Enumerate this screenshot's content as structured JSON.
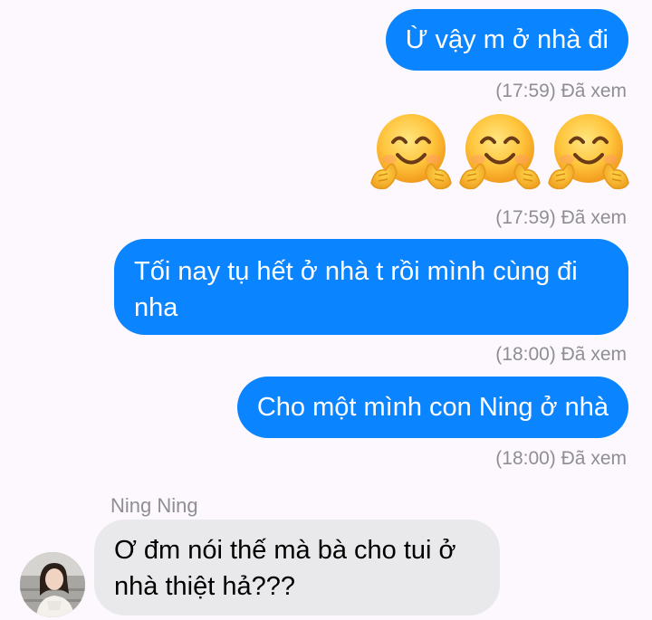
{
  "messages": [
    {
      "text": "Ừ  vậy m ở nhà đi",
      "status": "(17:59) Đã xem"
    },
    {
      "emojis": [
        "hugging-face-emoji",
        "hugging-face-emoji",
        "hugging-face-emoji"
      ],
      "status": "(17:59) Đã xem"
    },
    {
      "text": "Tối nay tụ hết ở nhà t rồi mình cùng đi nha",
      "status": "(18:00) Đã xem"
    },
    {
      "text": "Cho một mình con Ning ở nhà",
      "status": "(18:00) Đã xem"
    }
  ],
  "incoming": {
    "sender": "Ning Ning",
    "text": "Ơ đm nói thế mà bà cho tui ở nhà thiệt hả???"
  },
  "colors": {
    "outgoing_bubble": "#0a84ff",
    "incoming_bubble": "#e9e9eb",
    "status_text": "#8e8e93",
    "background": "#fdf8fd"
  }
}
